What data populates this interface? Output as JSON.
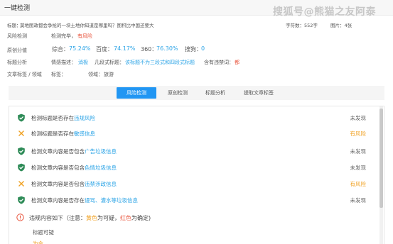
{
  "header": {
    "title": "一键检测"
  },
  "watermark": "搜狐号@熊猫之友阿泰",
  "info": {
    "title_label": "标题：",
    "title_value": "莫地图政都会争抢的一块土地你知道是哪里吗？图积比中国还要大",
    "word_count": "字符数：552字",
    "image_count": "图片：4张"
  },
  "rows": {
    "risk_label": "风险检测",
    "risk_value": "检测完毕，",
    "risk_highlight": "有风险",
    "original_label": "原创分值",
    "scores": [
      {
        "label": "综合：",
        "value": "75.24%"
      },
      {
        "label": "百度：",
        "value": "74.17%"
      },
      {
        "label": "360：",
        "value": "76.30%"
      },
      {
        "label": "搜狗：",
        "value": "0"
      }
    ],
    "title_analysis_label": "标题分析",
    "emotion_label": "情感描述：",
    "emotion_value": "消极",
    "structure_label": "几段式标题：",
    "structure_value": "该标题不为三段式和四段式标题",
    "sensitive_label": "含有违禁词：",
    "sensitive_value": "都",
    "tag_label": "文章标签 / 领域",
    "tag_value_label": "标签：",
    "field_label": "领域：",
    "field_value": "旅游"
  },
  "tabs": [
    {
      "label": "风险检测",
      "active": true
    },
    {
      "label": "原创检测",
      "active": false
    },
    {
      "label": "标题分析",
      "active": false
    },
    {
      "label": "提取文章标签",
      "active": false
    }
  ],
  "checks": [
    {
      "prefix": "检测标题是否存在",
      "keyword": "违规风险",
      "status": "未发现",
      "ok": true
    },
    {
      "prefix": "检测标题是否存在",
      "keyword": "敏感信息",
      "status": "有风险",
      "ok": false
    },
    {
      "prefix": "检测文章内容是否包含",
      "keyword": "广告垃圾信息",
      "status": "未发现",
      "ok": true
    },
    {
      "prefix": "检测文章内容是否包含",
      "keyword": "色情垃圾信息",
      "status": "未发现",
      "ok": true
    },
    {
      "prefix": "检测文章内容是否包含",
      "keyword": "违禁涉政信息",
      "status": "有风险",
      "ok": false
    },
    {
      "prefix": "检测文章内容是否存在",
      "keyword": "谩骂、灌水等垃圾信息",
      "status": "未发现",
      "ok": true
    }
  ],
  "note": {
    "prefix": "违规内容如下（注意：",
    "yellow": "黄色",
    "middle": "为可疑，",
    "red": "红色",
    "suffix": "为确定)",
    "sub1": "标题可疑",
    "sub2": "为今"
  },
  "colors": {
    "accent": "#2196f3",
    "ok_green": "#2e8b57",
    "risk_yellow": "#f0a020",
    "risk_red": "#e8523a"
  }
}
